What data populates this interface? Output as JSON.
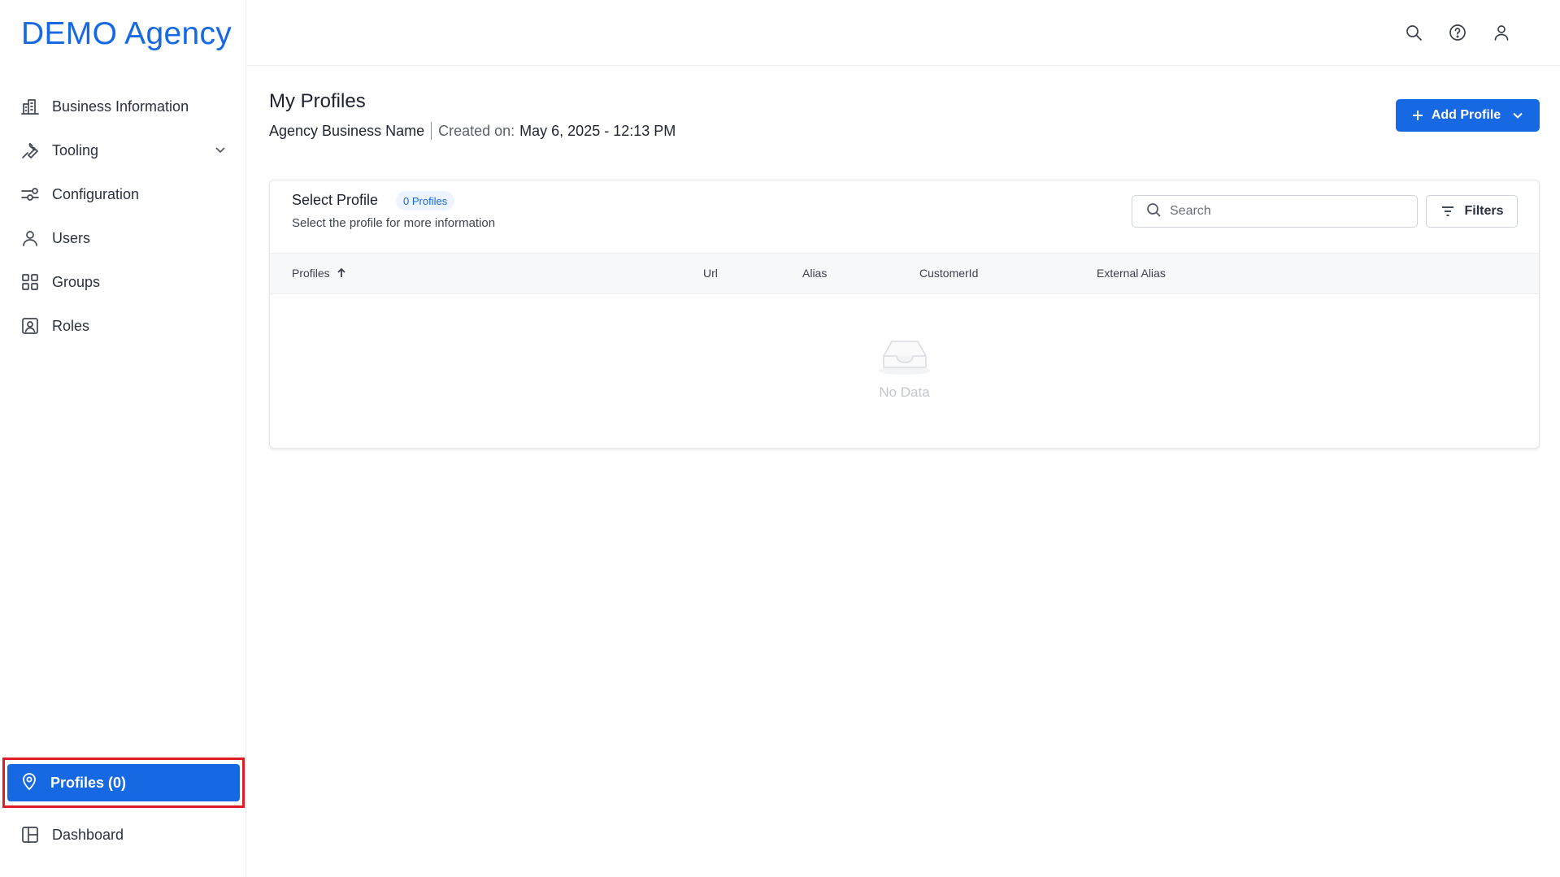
{
  "app": {
    "brand": "DEMO Agency"
  },
  "sidebar": {
    "items": [
      {
        "label": "Business Information",
        "icon": "building-icon"
      },
      {
        "label": "Tooling",
        "icon": "wrench-icon",
        "expandable": true
      },
      {
        "label": "Configuration",
        "icon": "sliders-icon"
      },
      {
        "label": "Users",
        "icon": "user-icon"
      },
      {
        "label": "Groups",
        "icon": "grid-icon"
      },
      {
        "label": "Roles",
        "icon": "id-badge-icon"
      }
    ],
    "bottom": [
      {
        "label": "Profiles (0)",
        "icon": "location-pin-icon",
        "active": true
      },
      {
        "label": "Dashboard",
        "icon": "layout-icon"
      }
    ]
  },
  "header": {
    "icons": [
      "search-icon",
      "help-icon",
      "user-icon"
    ]
  },
  "main": {
    "title": "My Profiles",
    "business_name": "Agency Business Name",
    "created_label": "Created on:",
    "created_value": "May 6, 2025 - 12:13 PM",
    "add_button": "Add Profile"
  },
  "card": {
    "title": "Select Profile",
    "count_badge": "0 Profiles",
    "subtitle": "Select the profile for more information",
    "search_placeholder": "Search",
    "filters_label": "Filters",
    "columns": [
      "Profiles",
      "Url",
      "Alias",
      "CustomerId",
      "External Alias"
    ],
    "empty_text": "No Data"
  },
  "colors": {
    "accent": "#1668e3",
    "highlight_frame": "#e01d24"
  }
}
